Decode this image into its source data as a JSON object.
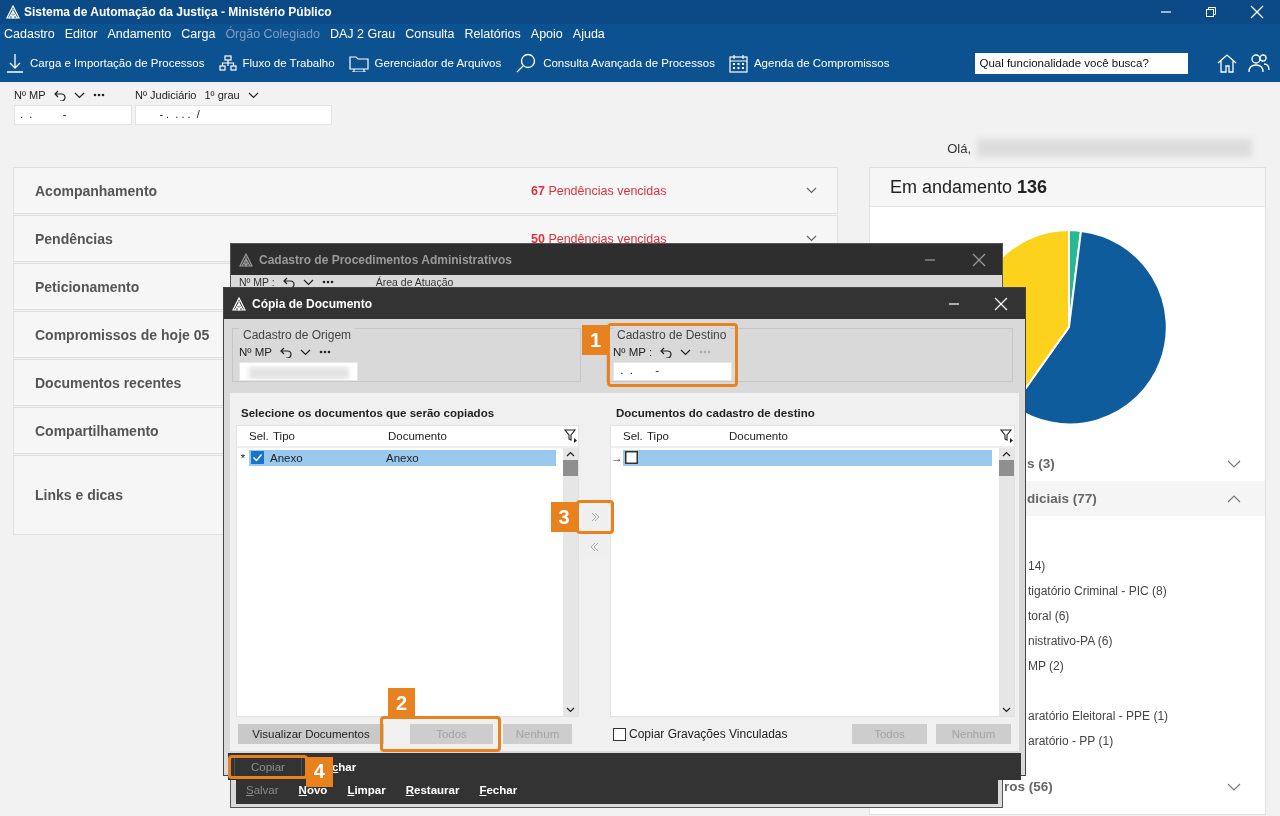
{
  "window": {
    "title": "Sistema de Automação da Justiça - Ministério Público"
  },
  "menu": [
    {
      "label": "Cadastro",
      "disabled": false
    },
    {
      "label": "Editor",
      "disabled": false
    },
    {
      "label": "Andamento",
      "disabled": false
    },
    {
      "label": "Carga",
      "disabled": false
    },
    {
      "label": "Órgão Colegiado",
      "disabled": true
    },
    {
      "label": "DAJ 2 Grau",
      "disabled": false
    },
    {
      "label": "Consulta",
      "disabled": false
    },
    {
      "label": "Relatórios",
      "disabled": false
    },
    {
      "label": "Apoio",
      "disabled": false
    },
    {
      "label": "Ajuda",
      "disabled": false
    }
  ],
  "toolbar": [
    {
      "label": "Carga e Importação de Processos"
    },
    {
      "label": "Fluxo de Trabalho"
    },
    {
      "label": "Gerenciador de Arquivos"
    },
    {
      "label": "Consulta Avançada de Processos"
    },
    {
      "label": "Agenda de Compromissos"
    }
  ],
  "search": {
    "placeholder": "Qual funcionalidade você busca?"
  },
  "lookup": {
    "mp_label": "Nº MP",
    "mp_value": " .  .          -",
    "judicial_label": "Nº Judiciário",
    "degree": "1º grau",
    "judicial_value": "       - .  . . .  /"
  },
  "greeting": "Olá,",
  "cards": [
    {
      "title": "Acompanhamento",
      "alert": "**67** Pendências vencidas"
    },
    {
      "title": "Pendências",
      "alert": "**50** Pendências vencidas"
    },
    {
      "title": "Peticionamento"
    },
    {
      "title": "Compromissos de hoje 05"
    },
    {
      "title": "Documentos recentes"
    },
    {
      "title": "Compartilhamento"
    },
    {
      "title": "Links e dicas"
    }
  ],
  "status_panel": {
    "title": "Em andamento **136**",
    "sections": [
      {
        "label": "s **(3)**",
        "expanded": false
      },
      {
        "label": "diciais **(77)**",
        "expanded": true,
        "items": [
          "14)",
          "tigatório Criminal - PIC (8)",
          "toral (6)",
          "nistrativo-PA (6)",
          "MP (2)",
          "aratório Eleitoral - PPE (1)",
          "aratório - PP (1)"
        ]
      },
      {
        "label": "ros **(56)**",
        "expanded": false
      }
    ]
  },
  "proc_window": {
    "title": "Cadastro de Procedimentos Administrativos",
    "mp_label": "Nº MP :",
    "area_label": "Área de Atuação",
    "actions": [
      {
        "label": "Salvar",
        "disabled": true
      },
      {
        "label": "Novo",
        "disabled": false
      },
      {
        "label": "Limpar",
        "disabled": false
      },
      {
        "label": "Restaurar",
        "disabled": false
      },
      {
        "label": "Fechar",
        "disabled": false
      }
    ]
  },
  "copy_dialog": {
    "title": "Cópia de Documento",
    "origin": {
      "legend": "Cadastro de Origem",
      "mp_label": "Nº MP"
    },
    "destination": {
      "legend": "Cadastro de Destino",
      "mp_label": "Nº MP :",
      "value": " .  .       -",
      "callout": "1"
    },
    "source_list": {
      "heading": "Selecione os documentos que serão copiados",
      "columns": [
        "Sel.",
        "Tipo",
        "Documento"
      ],
      "rows": [
        {
          "marker": "*",
          "checked": true,
          "selected": true,
          "tipo": "Anexo",
          "documento": "Anexo"
        }
      ]
    },
    "target_list": {
      "heading": "Documentos do cadastro de destino",
      "columns": [
        "Sel.",
        "Tipo",
        "Documento"
      ],
      "rows": [
        {
          "marker": "→",
          "checked": false,
          "selected": true
        }
      ]
    },
    "move_right": {
      "callout": "3"
    },
    "source_buttons": [
      {
        "label": "Visualizar Documentos",
        "disabled": false
      },
      {
        "label": "Todos",
        "disabled": true,
        "callout": "2"
      },
      {
        "label": "Nenhum",
        "disabled": true
      }
    ],
    "linked_recordings": {
      "label": "Copiar Gravações Vinculadas",
      "checked": false
    },
    "target_buttons": [
      {
        "label": "Todos",
        "disabled": true
      },
      {
        "label": "Nenhum",
        "disabled": true
      }
    ],
    "footer_actions": [
      {
        "label": "Copiar",
        "disabled": true,
        "callout": "4"
      },
      {
        "label": "char",
        "disabled": false
      }
    ]
  }
}
